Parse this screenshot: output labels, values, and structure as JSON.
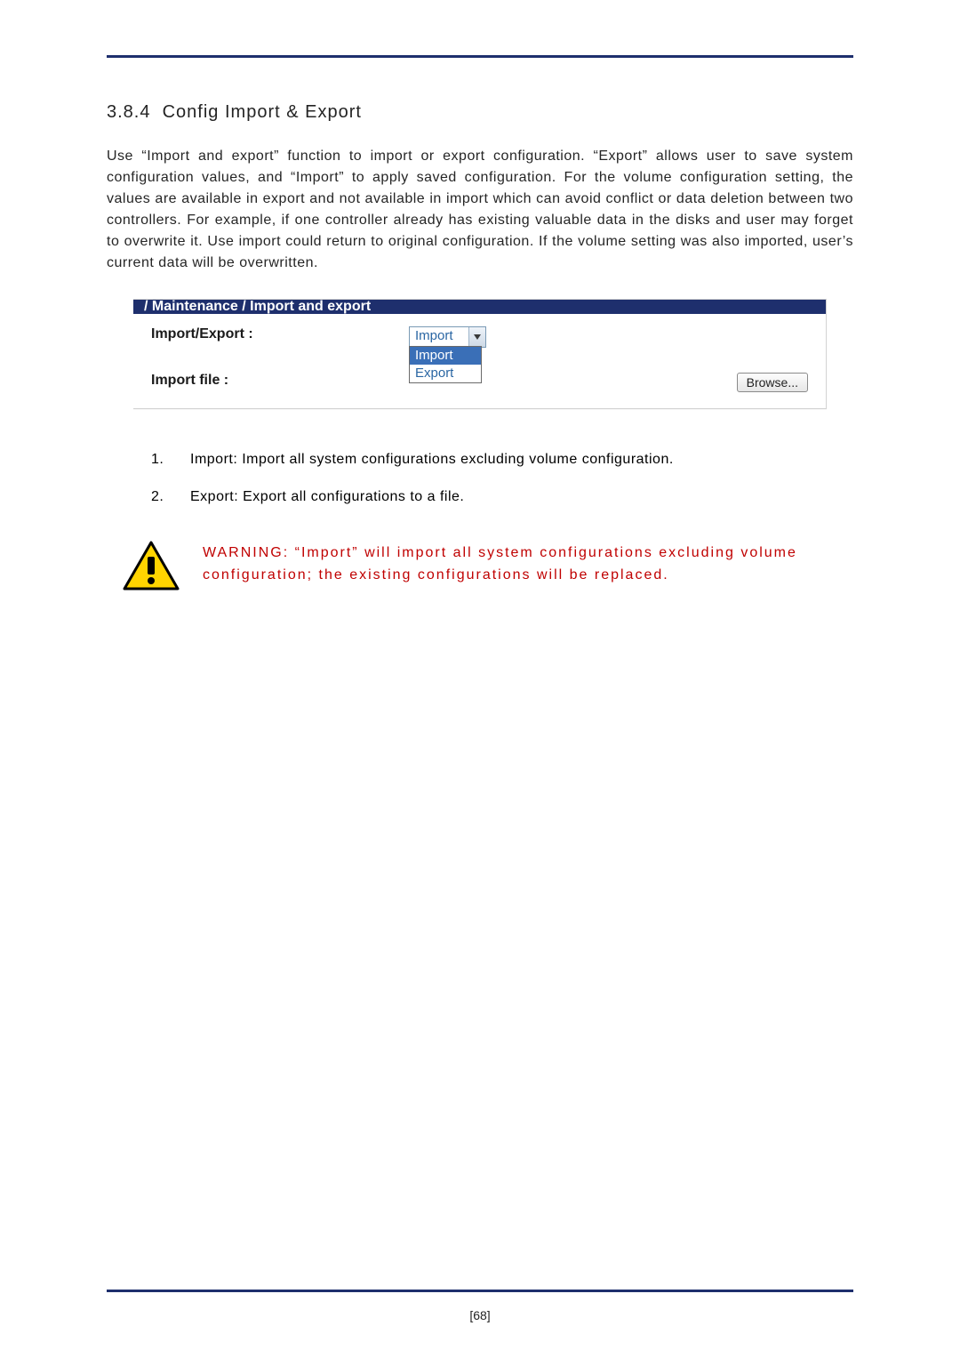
{
  "section": {
    "number": "3.8.4",
    "title": "Config Import & Export"
  },
  "paragraph": "Use “Import and export” function to import or export configuration. “Export” allows user to save system configuration values, and “Import” to apply saved configuration. For the volume configuration setting, the values are available in export and not available in import which can avoid conflict or data deletion between two controllers. For example, if one controller already has existing valuable data in the disks and user may forget to overwrite it. Use import could return to original configuration. If the volume setting was also imported, user’s current data will be overwritten.",
  "ui": {
    "breadcrumb": "/ Maintenance / Import and export",
    "rows": {
      "import_export": {
        "label": "Import/Export :",
        "selected": "Import",
        "options": [
          "Import",
          "Export"
        ]
      },
      "import_file": {
        "label": "Import file :",
        "browse": "Browse..."
      }
    }
  },
  "list": {
    "items": [
      {
        "num": "1.",
        "text": "Import: Import all system configurations excluding volume configuration."
      },
      {
        "num": "2.",
        "text": "Export: Export all configurations to a file."
      }
    ]
  },
  "warning": "WARNING: “Import” will import all system configurations excluding volume configuration; the existing configurations will be replaced.",
  "page_number": "[68]"
}
